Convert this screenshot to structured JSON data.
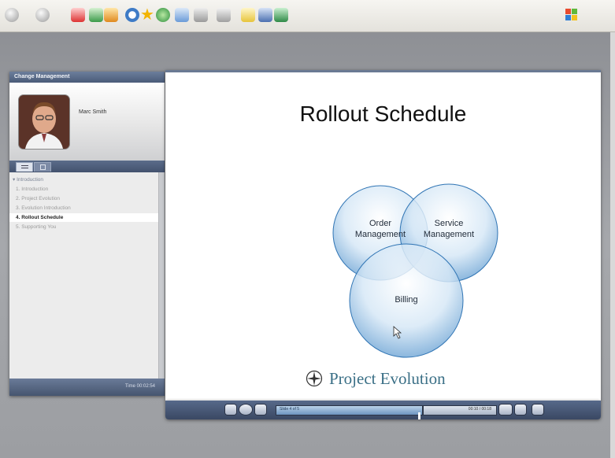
{
  "browser": {
    "toolbar_icons": [
      "back-icon",
      "forward-icon",
      "stop-icon",
      "refresh-icon",
      "home-icon",
      "search-icon",
      "favorites-icon",
      "history-icon",
      "mail-icon",
      "print-icon",
      "edit-icon",
      "discuss-icon",
      "research-icon",
      "messenger-icon"
    ],
    "windows_flag": "windows-flag-icon"
  },
  "left_panel": {
    "title": "Change Management",
    "presenter_name": "Marc Smith",
    "outline": [
      {
        "label": "▾ Introduction",
        "type": "section"
      },
      {
        "label": "1. Introduction",
        "type": "item"
      },
      {
        "label": "2. Project Evolution",
        "type": "item"
      },
      {
        "label": "3. Evolution Introduction",
        "type": "item"
      },
      {
        "label": "4. Rollout Schedule",
        "type": "active"
      },
      {
        "label": "5. Supporting You",
        "type": "item"
      }
    ],
    "time_label": "Time 00:02:54"
  },
  "slide": {
    "title": "Rollout Schedule",
    "circles": [
      {
        "label_lines": [
          "Order",
          "Management"
        ]
      },
      {
        "label_lines": [
          "Service",
          "Management"
        ]
      },
      {
        "label_lines": [
          "Billing"
        ]
      }
    ],
    "logo_text": "Project Evolution"
  },
  "player": {
    "slide_counter": "Slide 4 of 5",
    "time_readout": "00:10 / 00:18"
  },
  "colors": {
    "circle_fill": "#7fb3dc",
    "circle_edge": "#2f74b4",
    "panel_header": "#4a5b78",
    "logo_text": "#3a6f86"
  }
}
